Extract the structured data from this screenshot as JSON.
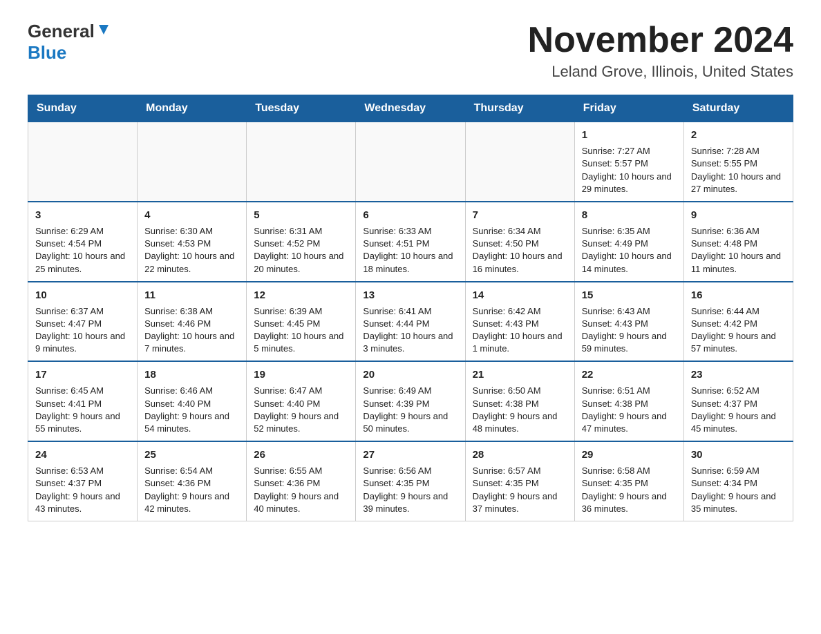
{
  "header": {
    "logo_general": "General",
    "logo_blue": "Blue",
    "title": "November 2024",
    "location": "Leland Grove, Illinois, United States"
  },
  "weekdays": [
    "Sunday",
    "Monday",
    "Tuesday",
    "Wednesday",
    "Thursday",
    "Friday",
    "Saturday"
  ],
  "weeks": [
    [
      {
        "day": "",
        "empty": true
      },
      {
        "day": "",
        "empty": true
      },
      {
        "day": "",
        "empty": true
      },
      {
        "day": "",
        "empty": true
      },
      {
        "day": "",
        "empty": true
      },
      {
        "day": "1",
        "sunrise": "Sunrise: 7:27 AM",
        "sunset": "Sunset: 5:57 PM",
        "daylight": "Daylight: 10 hours and 29 minutes."
      },
      {
        "day": "2",
        "sunrise": "Sunrise: 7:28 AM",
        "sunset": "Sunset: 5:55 PM",
        "daylight": "Daylight: 10 hours and 27 minutes."
      }
    ],
    [
      {
        "day": "3",
        "sunrise": "Sunrise: 6:29 AM",
        "sunset": "Sunset: 4:54 PM",
        "daylight": "Daylight: 10 hours and 25 minutes."
      },
      {
        "day": "4",
        "sunrise": "Sunrise: 6:30 AM",
        "sunset": "Sunset: 4:53 PM",
        "daylight": "Daylight: 10 hours and 22 minutes."
      },
      {
        "day": "5",
        "sunrise": "Sunrise: 6:31 AM",
        "sunset": "Sunset: 4:52 PM",
        "daylight": "Daylight: 10 hours and 20 minutes."
      },
      {
        "day": "6",
        "sunrise": "Sunrise: 6:33 AM",
        "sunset": "Sunset: 4:51 PM",
        "daylight": "Daylight: 10 hours and 18 minutes."
      },
      {
        "day": "7",
        "sunrise": "Sunrise: 6:34 AM",
        "sunset": "Sunset: 4:50 PM",
        "daylight": "Daylight: 10 hours and 16 minutes."
      },
      {
        "day": "8",
        "sunrise": "Sunrise: 6:35 AM",
        "sunset": "Sunset: 4:49 PM",
        "daylight": "Daylight: 10 hours and 14 minutes."
      },
      {
        "day": "9",
        "sunrise": "Sunrise: 6:36 AM",
        "sunset": "Sunset: 4:48 PM",
        "daylight": "Daylight: 10 hours and 11 minutes."
      }
    ],
    [
      {
        "day": "10",
        "sunrise": "Sunrise: 6:37 AM",
        "sunset": "Sunset: 4:47 PM",
        "daylight": "Daylight: 10 hours and 9 minutes."
      },
      {
        "day": "11",
        "sunrise": "Sunrise: 6:38 AM",
        "sunset": "Sunset: 4:46 PM",
        "daylight": "Daylight: 10 hours and 7 minutes."
      },
      {
        "day": "12",
        "sunrise": "Sunrise: 6:39 AM",
        "sunset": "Sunset: 4:45 PM",
        "daylight": "Daylight: 10 hours and 5 minutes."
      },
      {
        "day": "13",
        "sunrise": "Sunrise: 6:41 AM",
        "sunset": "Sunset: 4:44 PM",
        "daylight": "Daylight: 10 hours and 3 minutes."
      },
      {
        "day": "14",
        "sunrise": "Sunrise: 6:42 AM",
        "sunset": "Sunset: 4:43 PM",
        "daylight": "Daylight: 10 hours and 1 minute."
      },
      {
        "day": "15",
        "sunrise": "Sunrise: 6:43 AM",
        "sunset": "Sunset: 4:43 PM",
        "daylight": "Daylight: 9 hours and 59 minutes."
      },
      {
        "day": "16",
        "sunrise": "Sunrise: 6:44 AM",
        "sunset": "Sunset: 4:42 PM",
        "daylight": "Daylight: 9 hours and 57 minutes."
      }
    ],
    [
      {
        "day": "17",
        "sunrise": "Sunrise: 6:45 AM",
        "sunset": "Sunset: 4:41 PM",
        "daylight": "Daylight: 9 hours and 55 minutes."
      },
      {
        "day": "18",
        "sunrise": "Sunrise: 6:46 AM",
        "sunset": "Sunset: 4:40 PM",
        "daylight": "Daylight: 9 hours and 54 minutes."
      },
      {
        "day": "19",
        "sunrise": "Sunrise: 6:47 AM",
        "sunset": "Sunset: 4:40 PM",
        "daylight": "Daylight: 9 hours and 52 minutes."
      },
      {
        "day": "20",
        "sunrise": "Sunrise: 6:49 AM",
        "sunset": "Sunset: 4:39 PM",
        "daylight": "Daylight: 9 hours and 50 minutes."
      },
      {
        "day": "21",
        "sunrise": "Sunrise: 6:50 AM",
        "sunset": "Sunset: 4:38 PM",
        "daylight": "Daylight: 9 hours and 48 minutes."
      },
      {
        "day": "22",
        "sunrise": "Sunrise: 6:51 AM",
        "sunset": "Sunset: 4:38 PM",
        "daylight": "Daylight: 9 hours and 47 minutes."
      },
      {
        "day": "23",
        "sunrise": "Sunrise: 6:52 AM",
        "sunset": "Sunset: 4:37 PM",
        "daylight": "Daylight: 9 hours and 45 minutes."
      }
    ],
    [
      {
        "day": "24",
        "sunrise": "Sunrise: 6:53 AM",
        "sunset": "Sunset: 4:37 PM",
        "daylight": "Daylight: 9 hours and 43 minutes."
      },
      {
        "day": "25",
        "sunrise": "Sunrise: 6:54 AM",
        "sunset": "Sunset: 4:36 PM",
        "daylight": "Daylight: 9 hours and 42 minutes."
      },
      {
        "day": "26",
        "sunrise": "Sunrise: 6:55 AM",
        "sunset": "Sunset: 4:36 PM",
        "daylight": "Daylight: 9 hours and 40 minutes."
      },
      {
        "day": "27",
        "sunrise": "Sunrise: 6:56 AM",
        "sunset": "Sunset: 4:35 PM",
        "daylight": "Daylight: 9 hours and 39 minutes."
      },
      {
        "day": "28",
        "sunrise": "Sunrise: 6:57 AM",
        "sunset": "Sunset: 4:35 PM",
        "daylight": "Daylight: 9 hours and 37 minutes."
      },
      {
        "day": "29",
        "sunrise": "Sunrise: 6:58 AM",
        "sunset": "Sunset: 4:35 PM",
        "daylight": "Daylight: 9 hours and 36 minutes."
      },
      {
        "day": "30",
        "sunrise": "Sunrise: 6:59 AM",
        "sunset": "Sunset: 4:34 PM",
        "daylight": "Daylight: 9 hours and 35 minutes."
      }
    ]
  ]
}
